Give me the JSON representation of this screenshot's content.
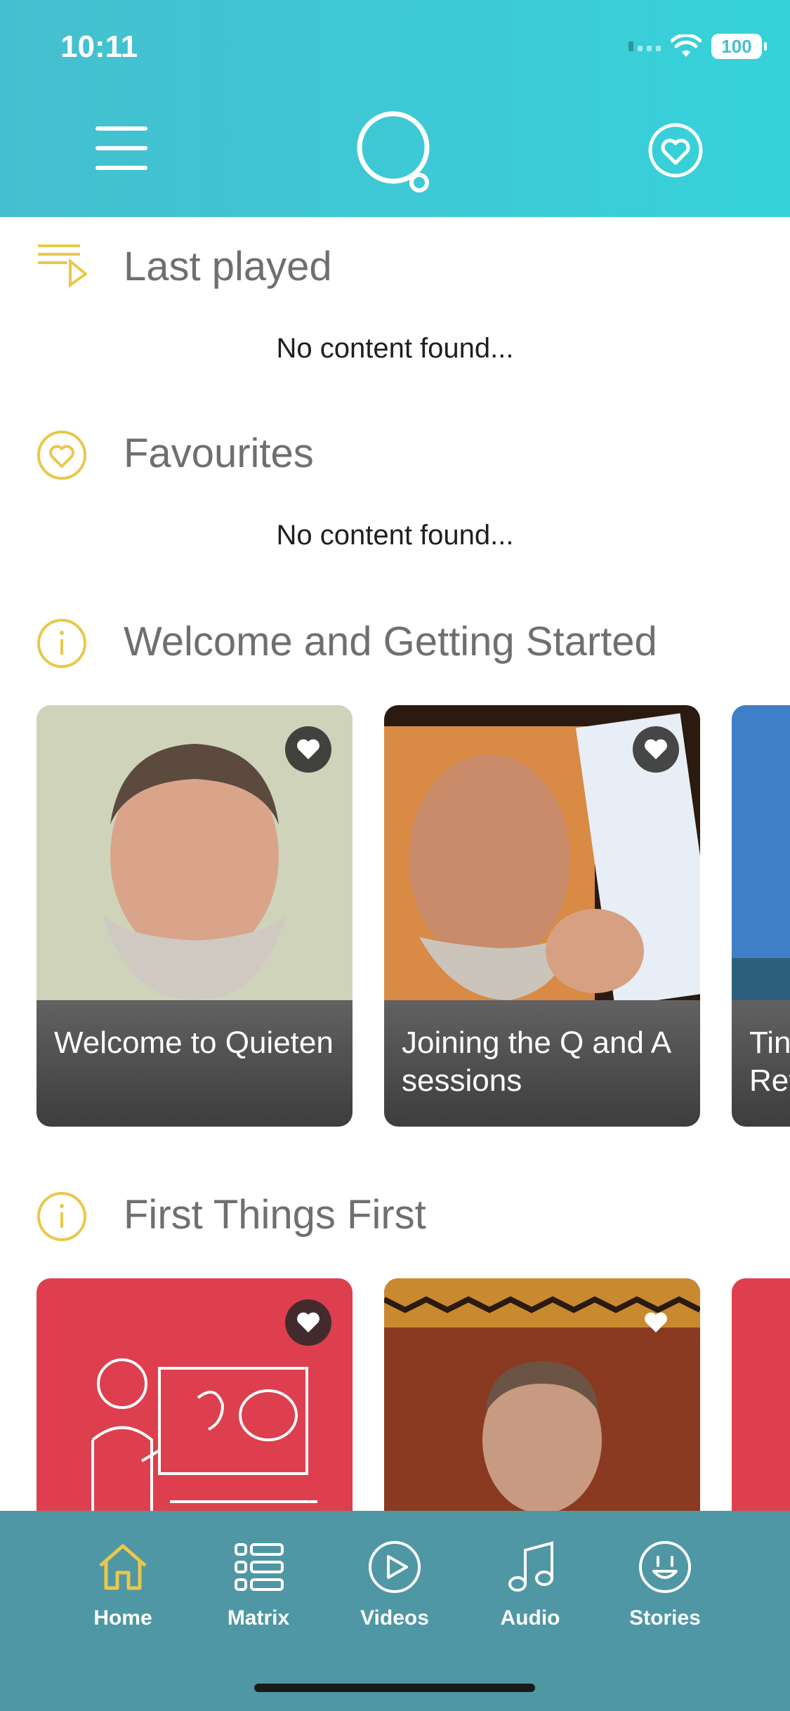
{
  "status": {
    "time": "10:11",
    "battery": "100"
  },
  "sections": {
    "last_played": {
      "title": "Last played",
      "empty": "No content found..."
    },
    "favourites": {
      "title": "Favourites",
      "empty": "No content found..."
    },
    "welcome": {
      "title": "Welcome and Getting Started",
      "cards": [
        {
          "label": "Welcome to Quieten"
        },
        {
          "label": "Joining the Q and A sessions"
        },
        {
          "label": "Tin Ret"
        }
      ]
    },
    "first_things": {
      "title": "First Things First"
    }
  },
  "tabs": [
    {
      "label": "Home",
      "icon": "home-icon",
      "active": true
    },
    {
      "label": "Matrix",
      "icon": "matrix-icon"
    },
    {
      "label": "Videos",
      "icon": "play-icon"
    },
    {
      "label": "Audio",
      "icon": "music-icon"
    },
    {
      "label": "Stories",
      "icon": "smile-icon"
    }
  ],
  "colors": {
    "header": "#36d2da",
    "tabbar": "#4f97a4",
    "accent_yellow": "#e9c84a",
    "card_red": "#dd3f4e"
  }
}
